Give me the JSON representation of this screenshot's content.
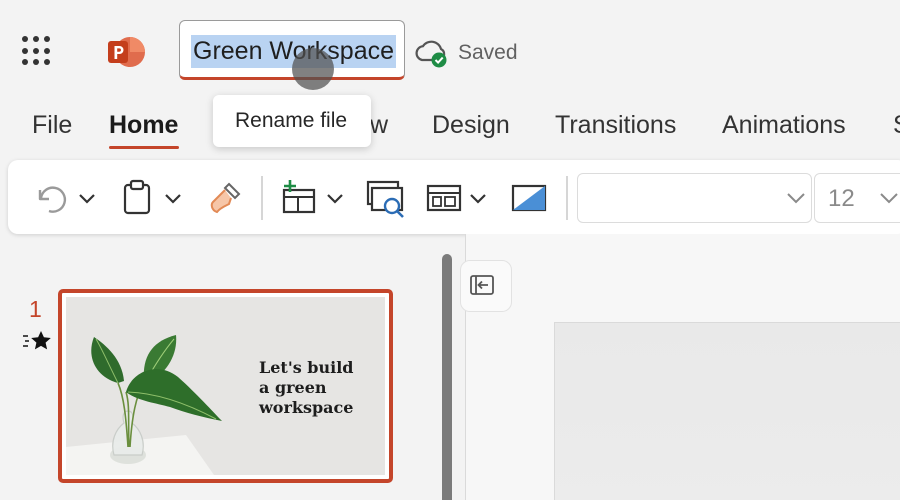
{
  "titlebar": {
    "file_name": "Green Workspace",
    "save_status": "Saved"
  },
  "tooltip": {
    "text": "Rename file"
  },
  "tabs": [
    {
      "label": "File"
    },
    {
      "label": "Home"
    },
    {
      "label": "w"
    },
    {
      "label": "Design"
    },
    {
      "label": "Transitions"
    },
    {
      "label": "Animations"
    },
    {
      "label": "S"
    }
  ],
  "ribbon": {
    "font_name": "",
    "font_size": "12"
  },
  "slides": [
    {
      "number": "1",
      "title_lines": [
        "Let's build",
        "a green",
        "workspace"
      ]
    }
  ],
  "colors": {
    "accent": "#c4452a",
    "selection": "#b9d3f2"
  }
}
